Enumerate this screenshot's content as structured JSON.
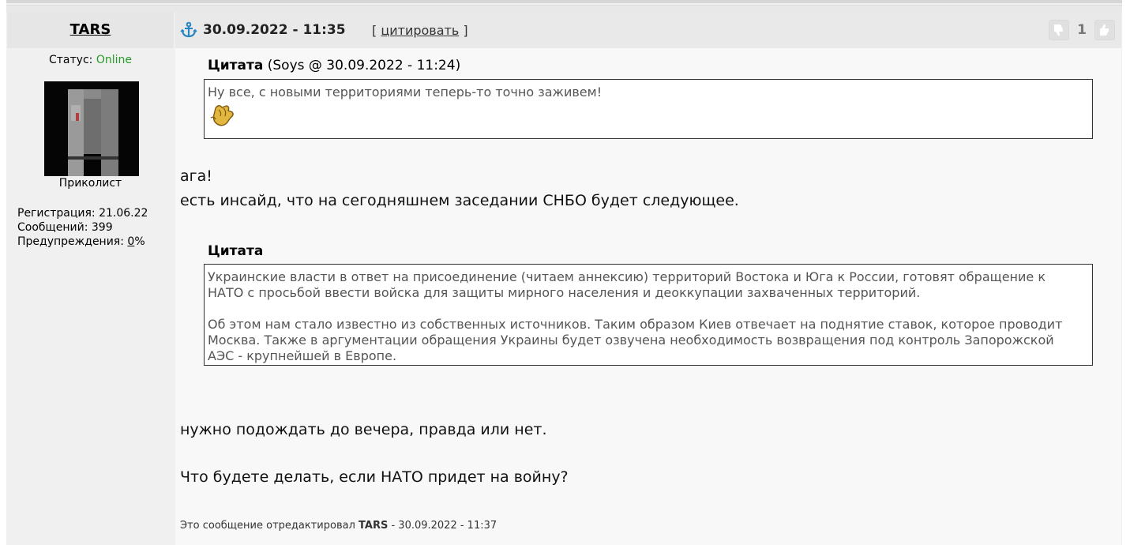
{
  "author": {
    "name": "TARS",
    "status_label": "Статус:",
    "status_value": "Online",
    "rank": "Приколист",
    "registration_label": "Регистрация:",
    "registration_value": "21.06.22",
    "posts_label": "Сообщений:",
    "posts_value": "399",
    "warnings_label": "Предупреждения:",
    "warnings_value": "0",
    "warnings_unit": "%"
  },
  "post": {
    "datetime": "30.09.2022 - 11:35",
    "quote_button": "цитировать",
    "quote_open": "[",
    "quote_close": "]",
    "rating": "1",
    "quote1_label": "Цитата",
    "quote1_meta": "(Soys @ 30.09.2022 - 11:24)",
    "quote1_text": "Ну все, с новыми территориями теперь-то точно заживем!",
    "reply_line1": "ага!",
    "reply_line2": "есть инсайд, что на сегодняшнем заседании СНБО будет следующее.",
    "quote2_label": "Цитата",
    "quote2_para1": "Украинские власти в ответ на присоединение (читаем аннексию) территорий Востока и Юга к России, готовят обращение к НАТО с просьбой ввести войска для защиты мирного населения и деоккупации захваченных территорий.",
    "quote2_para2": "Об этом нам стало известно из собственных источников. Таким образом Киев отвечает на поднятие ставок, которое проводит Москва. Также в аргументации обращения Украины будет озвучена необходимость возвращения под контроль Запорожской АЭС - крупнейшей в Европе.",
    "reply_line3": "нужно подождать до вечера, правда или нет.",
    "reply_line4": "Что будете делать, если НАТО придет на войну?",
    "edited_prefix": "Это сообщение отредактировал",
    "edited_by": "TARS",
    "edited_suffix": "- 30.09.2022 - 11:37"
  },
  "icons": {
    "anchor": "anchor-icon",
    "thumbs_down": "thumbs-down-icon",
    "thumbs_up": "thumbs-up-icon",
    "emoticon": "clapping-hands-smiley"
  },
  "colors": {
    "online": "#2a9a2a",
    "anchor": "#2a86c0",
    "header_bg": "#e9e9e9"
  }
}
